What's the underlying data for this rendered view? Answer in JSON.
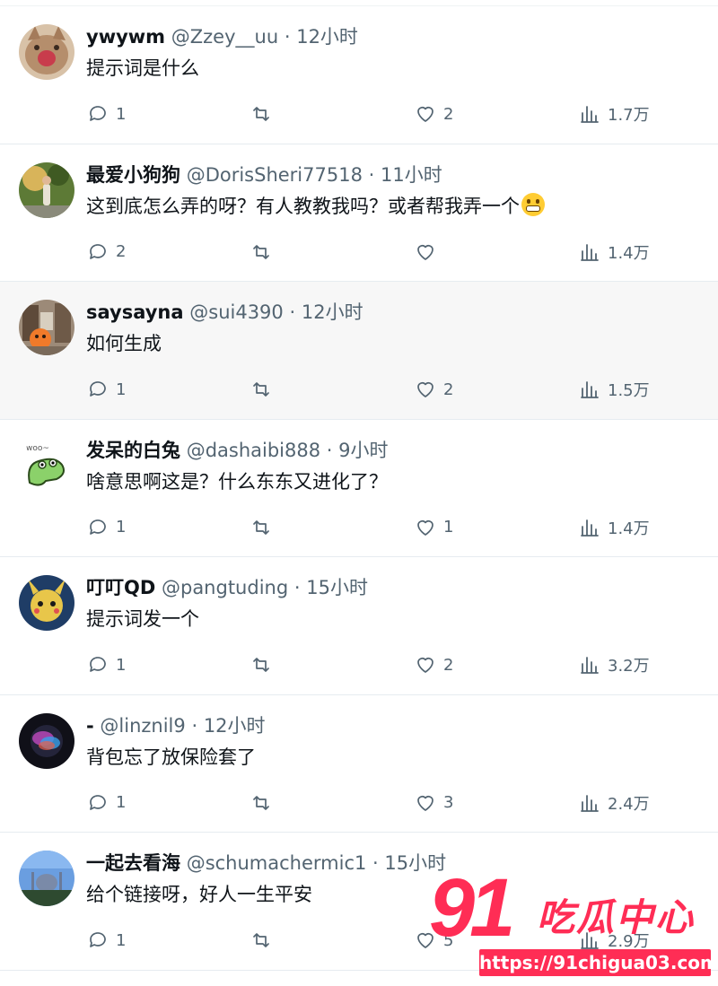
{
  "tweets": [
    {
      "name": "ywywm",
      "handle": "@Zzey__uu",
      "time": "12小时",
      "text": "提示词是什么",
      "replies": "1",
      "retweets": "",
      "likes": "2",
      "views": "1.7万",
      "avatar_colors": [
        "#c9a98c",
        "#8a5a44"
      ],
      "avatar_icon": "cat-photo"
    },
    {
      "name": "最爱小狗狗",
      "handle": "@DorisSheri77518",
      "time": "11小时",
      "text": "这到底怎么弄的呀？有人教教我吗？或者帮我弄一个",
      "emoji": "grimacing-face",
      "replies": "2",
      "retweets": "",
      "likes": "",
      "views": "1.4万",
      "avatar_colors": [
        "#4e6b2a",
        "#d6b25a"
      ],
      "avatar_icon": "person-photo"
    },
    {
      "name": "saysayna",
      "handle": "@sui4390",
      "time": "12小时",
      "text": "如何生成",
      "replies": "1",
      "retweets": "",
      "likes": "2",
      "views": "1.5万",
      "avatar_colors": [
        "#8b6b52",
        "#f07a2a"
      ],
      "avatar_icon": "street-photo"
    },
    {
      "name": "发呆的白兔",
      "handle": "@dashaibi888",
      "time": "9小时",
      "text": "啥意思啊这是？什么东东又进化了？",
      "replies": "1",
      "retweets": "",
      "likes": "1",
      "views": "1.4万",
      "avatar_colors": [
        "#ffffff",
        "#7cc35b"
      ],
      "avatar_icon": "dino-sticker"
    },
    {
      "name": "叮叮QD",
      "handle": "@pangtuding",
      "time": "15小时",
      "text": "提示词发一个",
      "replies": "1",
      "retweets": "",
      "likes": "2",
      "views": "3.2万",
      "avatar_colors": [
        "#2a4e78",
        "#e8c64a"
      ],
      "avatar_icon": "pikachu-art"
    },
    {
      "name": "-",
      "handle": "@linznil9",
      "time": "12小时",
      "text": "背包忘了放保险套了",
      "replies": "1",
      "retweets": "",
      "likes": "3",
      "views": "2.4万",
      "avatar_colors": [
        "#1a1a2e",
        "#c04ac0"
      ],
      "avatar_icon": "siri-orb"
    },
    {
      "name": "一起去看海",
      "handle": "@schumachermic1",
      "time": "15小时",
      "text": "给个链接呀，好人一生平安",
      "replies": "1",
      "retweets": "",
      "likes": "5",
      "views": "2.9万",
      "avatar_colors": [
        "#5a8fd6",
        "#2c4a2a"
      ],
      "avatar_icon": "mosque-photo"
    }
  ],
  "watermark": {
    "number": "91",
    "brand": "吃瓜中心",
    "url": "https://91chigua03.com"
  },
  "colors": {
    "accent": "#ff2d55",
    "muted": "#536471",
    "text": "#0f1419",
    "highlight_bg": "#f7f7f7"
  },
  "icons": {
    "reply": "comment-bubble-icon",
    "retweet": "retweet-icon",
    "like": "heart-icon",
    "views": "bar-chart-icon"
  }
}
